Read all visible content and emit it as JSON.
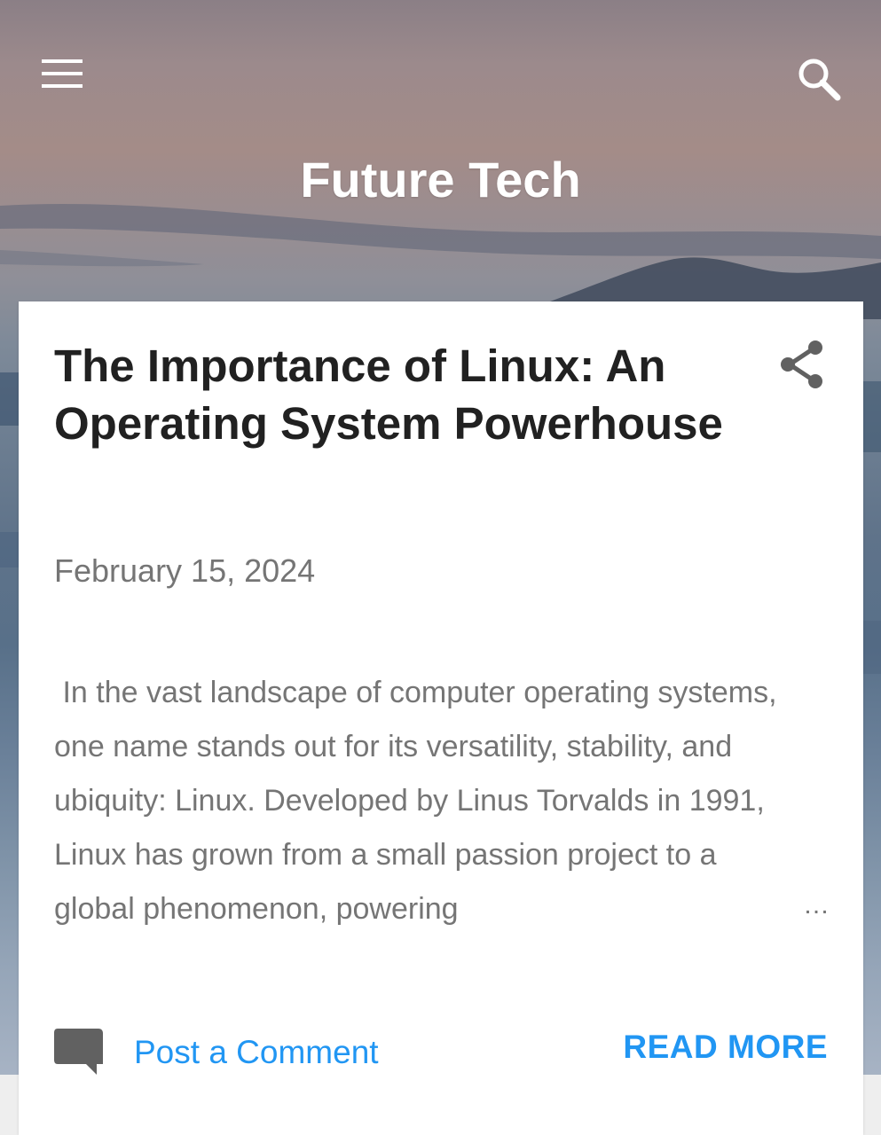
{
  "header": {
    "blog_title": "Future Tech",
    "menu_icon": "hamburger-menu-icon",
    "search_icon": "search-icon"
  },
  "post": {
    "title": "The Importance of Linux: An Operating System Powerhouse",
    "date": "February 15, 2024",
    "share_icon": "share-icon",
    "snippet": "In the vast landscape of computer operating systems, one name stands out for its versatility, stability, and ubiquity: Linux. Developed by Linus Torvalds in 1991, Linux has grown from a small passion project to a global phenomenon, powering",
    "ellipsis": "…",
    "comment_icon": "comment-icon",
    "comment_label": "Post a Comment",
    "read_more_label": "READ MORE"
  },
  "colors": {
    "accent": "#2196f3",
    "title_text": "#212121",
    "muted_text": "#757575",
    "icon_gray": "#616161"
  }
}
